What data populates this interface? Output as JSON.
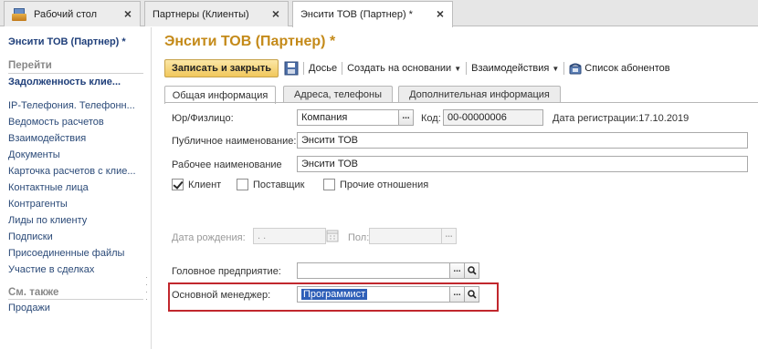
{
  "window_tabs": [
    {
      "label": "Рабочий стол",
      "icon": "home-icon"
    },
    {
      "label": "Партнеры (Клиенты)"
    },
    {
      "label": "Энсити ТОВ (Партнер) *",
      "active": true
    }
  ],
  "sidebar": {
    "title": "Энсити ТОВ (Партнер) *",
    "section_goto": "Перейти",
    "items": [
      "Задолженность клие...",
      "IP-Телефония. Телефонн...",
      "Ведомость расчетов",
      "Взаимодействия",
      "Документы",
      "Карточка расчетов с клие...",
      "Контактные лица",
      "Контрагенты",
      "Лиды по клиенту",
      "Подписки",
      "Присоединенные файлы",
      "Участие в сделках"
    ],
    "section_see_also": "См. также",
    "see_also_items": [
      "Продажи"
    ]
  },
  "form": {
    "title": "Энсити ТОВ (Партнер) *",
    "toolbar": {
      "save_close": "Записать и закрыть",
      "dossier": "Досье",
      "create_based": "Создать на основании",
      "interactions": "Взаимодействия",
      "subscribers_list": "Список абонентов"
    },
    "tabs": [
      "Общая информация",
      "Адреса, телефоны",
      "Дополнительная информация"
    ],
    "fields": {
      "legal_type_label": "Юр/Физлицо:",
      "legal_type_value": "Компания",
      "code_label": "Код:",
      "code_value": "00-00000006",
      "reg_date_label": "Дата регистрации:",
      "reg_date_value": "17.10.2019",
      "public_name_label": "Публичное наименование:",
      "public_name_value": "Энсити ТОВ",
      "work_name_label": "Рабочее наименование",
      "work_name_value": "Энсити ТОВ",
      "birth_date_label": "Дата рождения:",
      "birth_date_value": " .  . ",
      "gender_label": "Пол:",
      "gender_value": "",
      "head_company_label": "Головное предприятие:",
      "head_company_value": "",
      "main_manager_label": "Основной менеджер:",
      "main_manager_value": "Программист"
    },
    "checkboxes": [
      {
        "label": "Клиент",
        "checked": true
      },
      {
        "label": "Поставщик",
        "checked": false
      },
      {
        "label": "Прочие отношения",
        "checked": false
      }
    ],
    "colors": {
      "title": "#c48a19",
      "highlight": "#c1272d",
      "selection": "#2e5fb8"
    }
  }
}
